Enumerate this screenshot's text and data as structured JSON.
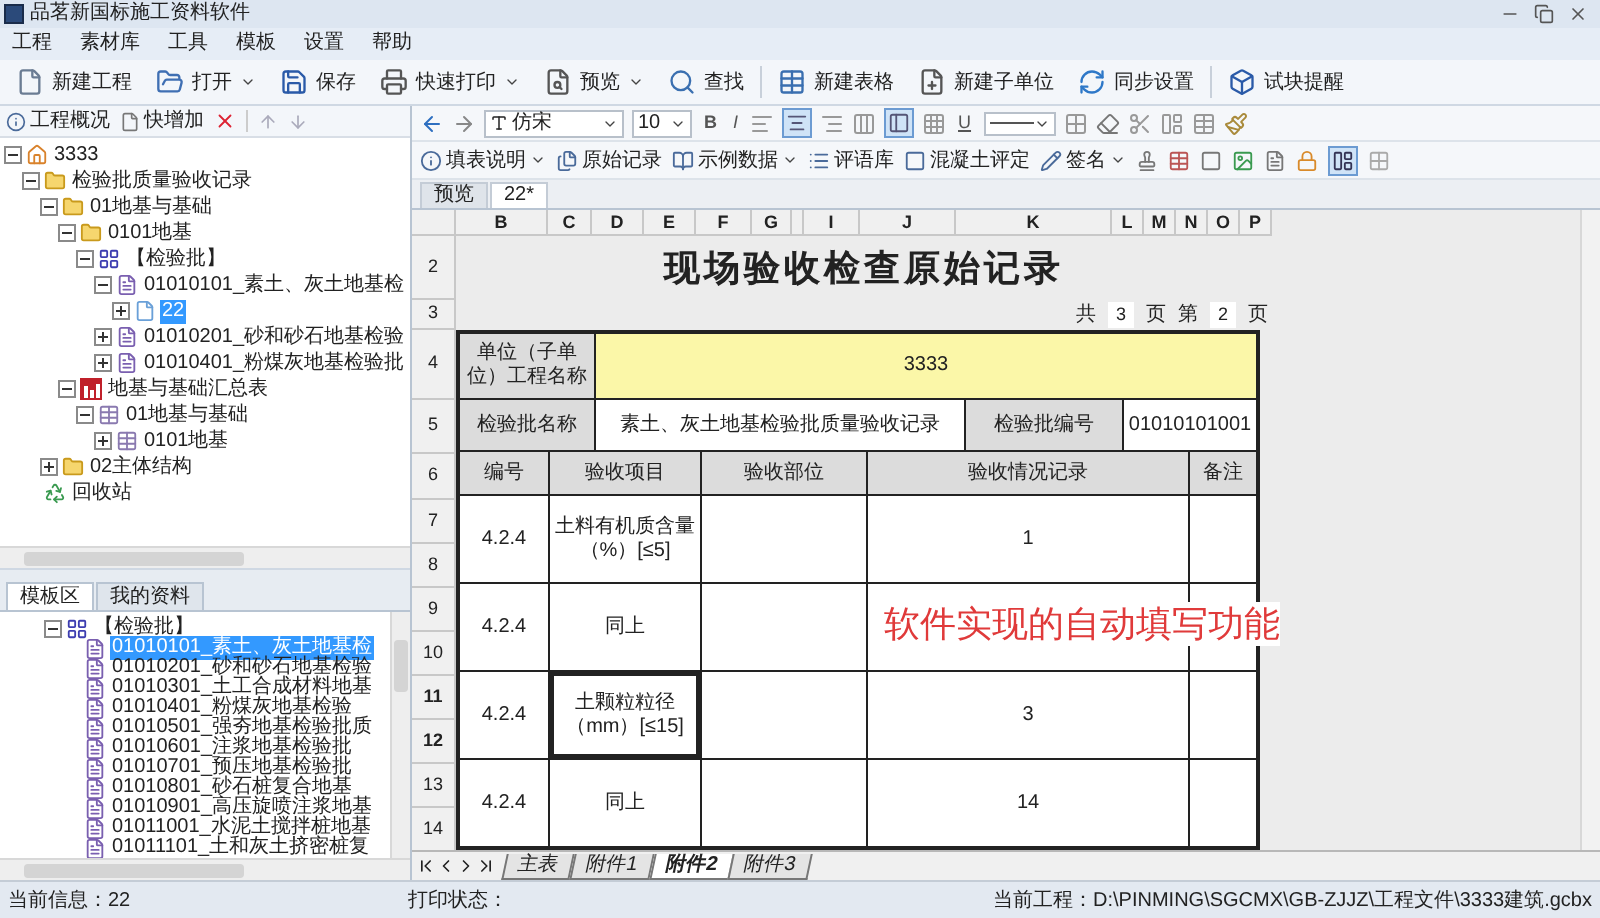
{
  "window": {
    "title": "品茗新国标施工资料软件"
  },
  "menu": [
    "工程",
    "素材库",
    "工具",
    "模板",
    "设置",
    "帮助"
  ],
  "toolbar": [
    {
      "label": "新建工程",
      "dropdown": false
    },
    {
      "label": "打开",
      "dropdown": true
    },
    {
      "label": "保存",
      "dropdown": false
    },
    {
      "label": "快速打印",
      "dropdown": true
    },
    {
      "label": "预览",
      "dropdown": true
    },
    {
      "label": "查找",
      "dropdown": false
    },
    {
      "label": "新建表格",
      "dropdown": false
    },
    {
      "label": "新建子单位",
      "dropdown": false
    },
    {
      "label": "同步设置",
      "dropdown": false
    },
    {
      "label": "试块提醒",
      "dropdown": false
    }
  ],
  "panel_toolbar": [
    {
      "label": "工程概况"
    },
    {
      "label": "快增加"
    }
  ],
  "project_tree": [
    {
      "label": "3333",
      "kind": "project",
      "expanded": true,
      "selected": false,
      "children": [
        {
          "label": "检验批质量验收记录",
          "kind": "folder",
          "expanded": true,
          "selected": false,
          "children": [
            {
              "label": "01地基与基础",
              "kind": "folder",
              "expanded": true,
              "selected": false,
              "children": [
                {
                  "label": "0101地基",
                  "kind": "folder",
                  "expanded": true,
                  "selected": false,
                  "children": [
                    {
                      "label": "【检验批】",
                      "kind": "batch",
                      "expanded": true,
                      "selected": false,
                      "children": [
                        {
                          "label": "01010101_素土、灰土地基检",
                          "kind": "form",
                          "expanded": true,
                          "selected": false,
                          "children": [
                            {
                              "label": "22",
                              "kind": "page",
                              "expanded": false,
                              "selected": true
                            }
                          ]
                        },
                        {
                          "label": "01010201_砂和砂石地基检验",
                          "kind": "form",
                          "expanded": false,
                          "selected": false
                        },
                        {
                          "label": "01010401_粉煤灰地基检验批",
                          "kind": "form",
                          "expanded": false,
                          "selected": false
                        }
                      ]
                    }
                  ]
                },
                {
                  "label": "地基与基础汇总表",
                  "kind": "summary",
                  "expanded": true,
                  "selected": false,
                  "children": [
                    {
                      "label": "01地基与基础",
                      "kind": "summary-group",
                      "expanded": true,
                      "selected": false,
                      "children": [
                        {
                          "label": "0101地基",
                          "kind": "summary-group",
                          "expanded": false,
                          "selected": false
                        }
                      ]
                    }
                  ]
                }
              ]
            },
            {
              "label": "02主体结构",
              "kind": "folder",
              "expanded": false,
              "selected": false
            }
          ]
        },
        {
          "label": "回收站",
          "kind": "recycle",
          "selected": false
        }
      ]
    }
  ],
  "library_tabs": [
    {
      "label": "模板区",
      "selected": true
    },
    {
      "label": "我的资料",
      "selected": false
    }
  ],
  "template_tree": [
    {
      "label": "【检验批】",
      "kind": "batch",
      "expanded": true,
      "selected": false,
      "children": [
        {
          "label": "01010101_素土、灰土地基检",
          "kind": "form",
          "selected": true
        },
        {
          "label": "01010201_砂和砂石地基检验",
          "kind": "form",
          "selected": false
        },
        {
          "label": "01010301_土工合成材料地基",
          "kind": "form",
          "selected": false
        },
        {
          "label": "01010401_粉煤灰地基检验",
          "kind": "form",
          "selected": false
        },
        {
          "label": "01010501_强夯地基检验批质",
          "kind": "form",
          "selected": false
        },
        {
          "label": "01010601_注浆地基检验批",
          "kind": "form",
          "selected": false
        },
        {
          "label": "01010701_预压地基检验批",
          "kind": "form",
          "selected": false
        },
        {
          "label": "01010801_砂石桩复合地基",
          "kind": "form",
          "selected": false
        },
        {
          "label": "01010901_高压旋喷注浆地基",
          "kind": "form",
          "selected": false
        },
        {
          "label": "01011001_水泥土搅拌桩地基",
          "kind": "form",
          "selected": false
        },
        {
          "label": "01011101_土和灰土挤密桩复",
          "kind": "form",
          "selected": false
        }
      ]
    }
  ],
  "format_toolbar": {
    "font": "仿宋",
    "size": "10",
    "bold": "B",
    "italic": "I",
    "underline": "U",
    "align_center_pressed": true,
    "wrap_pressed": true
  },
  "record_toolbar": {
    "items": [
      {
        "label": "填表说明",
        "dropdown": true
      },
      {
        "label": "原始记录",
        "dropdown": false
      },
      {
        "label": "示例数据",
        "dropdown": true
      },
      {
        "label": "评语库",
        "dropdown": false
      },
      {
        "label": "混凝土评定",
        "dropdown": false
      },
      {
        "label": "签名",
        "dropdown": true
      }
    ],
    "view_pressed": true
  },
  "doc_tabs": [
    {
      "label": "预览",
      "selected": false
    },
    {
      "label": "22*",
      "selected": true
    }
  ],
  "sheet": {
    "columns": [
      "B",
      "C",
      "D",
      "E",
      "F",
      "G",
      "I",
      "J",
      "K",
      "L",
      "M",
      "N",
      "O",
      "P"
    ],
    "rows": [
      {
        "label": "2",
        "selected": false
      },
      {
        "label": "3",
        "selected": false
      },
      {
        "label": "4",
        "selected": false
      },
      {
        "label": "5",
        "selected": false
      },
      {
        "label": "6",
        "selected": false
      },
      {
        "label": "7",
        "selected": false
      },
      {
        "label": "8",
        "selected": false
      },
      {
        "label": "9",
        "selected": false
      },
      {
        "label": "10",
        "selected": false
      },
      {
        "label": "11",
        "selected": true
      },
      {
        "label": "12",
        "selected": true
      },
      {
        "label": "13",
        "selected": false
      },
      {
        "label": "14",
        "selected": false
      }
    ],
    "title": "现场验收检查原始记录",
    "page": {
      "total_label": "共",
      "total": "3",
      "total_unit": "页",
      "current_label": "第",
      "current": "2",
      "current_unit": "页"
    },
    "project_label": "单位（子单位）工程名称",
    "project_value": "3333",
    "batch_name_label": "检验批名称",
    "batch_name": "素土、灰土地基检验批质量验收记录",
    "batch_no_label": "检验批编号",
    "batch_no": "01010101001",
    "headers": [
      "编号",
      "验收项目",
      "验收部位",
      "验收情况记录",
      "备注"
    ],
    "records": [
      {
        "code": "4.2.4",
        "item": "土料有机质含量（%）[≤5]",
        "result": "1",
        "selected": false
      },
      {
        "code": "4.2.4",
        "item": "同上",
        "selected": false
      },
      {
        "code": "4.2.4",
        "item": "土颗粒粒径（mm）[≤15]",
        "result": "3",
        "selected": true
      },
      {
        "code": "4.2.4",
        "item": "同上",
        "result": "14",
        "selected": false
      }
    ],
    "annotation": "软件实现的自动填写功能"
  },
  "sheet_tabs": [
    {
      "label": "主表",
      "selected": false
    },
    {
      "label": "附件1",
      "selected": false
    },
    {
      "label": "附件2",
      "selected": true
    },
    {
      "label": "附件3",
      "selected": false
    }
  ],
  "status_bar": {
    "info": "当前信息：22",
    "print": "打印状态：",
    "project": "当前工程：D:\\PINMING\\SGCMX\\GB-ZJJZ\\工程文件\\3333建筑.gcbx"
  }
}
